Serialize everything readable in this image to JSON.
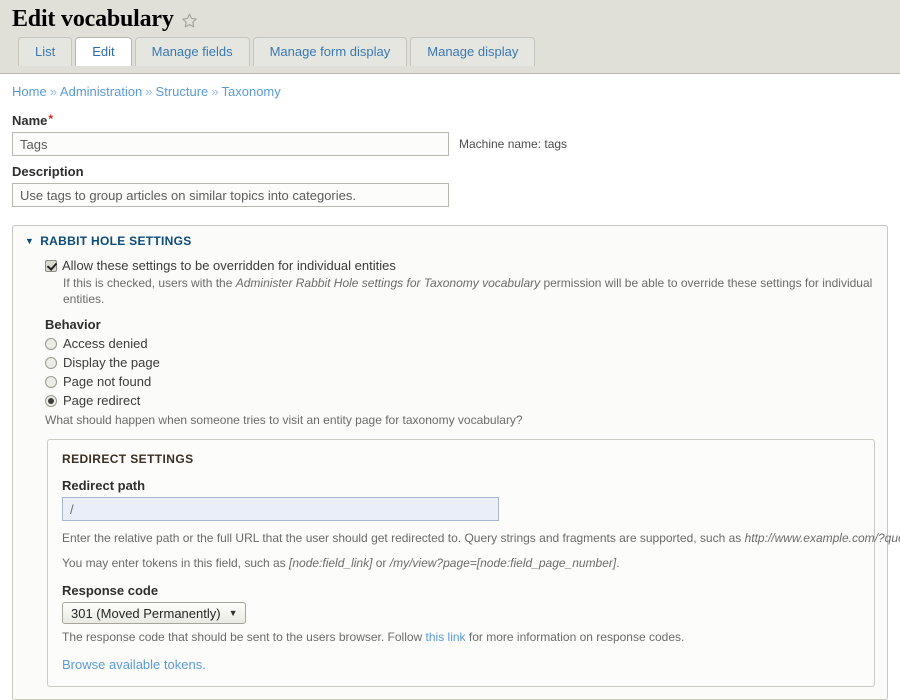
{
  "header": {
    "title": "Edit vocabulary",
    "star_icon": "star-outline-icon"
  },
  "tabs": [
    {
      "label": "List",
      "active": false
    },
    {
      "label": "Edit",
      "active": true
    },
    {
      "label": "Manage fields",
      "active": false
    },
    {
      "label": "Manage form display",
      "active": false
    },
    {
      "label": "Manage display",
      "active": false
    }
  ],
  "breadcrumb": {
    "items": [
      "Home",
      "Administration",
      "Structure",
      "Taxonomy"
    ],
    "separator": "»"
  },
  "form": {
    "name_label": "Name",
    "name_required_mark": "*",
    "name_value": "Tags",
    "machine_name": "Machine name: tags",
    "description_label": "Description",
    "description_value": "Use tags to group articles on similar topics into categories."
  },
  "rabbit_hole": {
    "legend": "RABBIT HOLE SETTINGS",
    "caret": "▼",
    "override_checkbox_label": "Allow these settings to be overridden for individual entities",
    "override_checked": true,
    "override_help_pre": "If this is checked, users with the ",
    "override_help_em": "Administer Rabbit Hole settings for Taxonomy vocabulary",
    "override_help_post": " permission will be able to override these settings for individual entities.",
    "behavior_label": "Behavior",
    "behavior_options": [
      {
        "label": "Access denied",
        "selected": false
      },
      {
        "label": "Display the page",
        "selected": false
      },
      {
        "label": "Page not found",
        "selected": false
      },
      {
        "label": "Page redirect",
        "selected": true
      }
    ],
    "behavior_help": "What should happen when someone tries to visit an entity page for taxonomy vocabulary?"
  },
  "redirect_settings": {
    "title": "REDIRECT SETTINGS",
    "path_label": "Redirect path",
    "path_value": "/",
    "path_help_pre": "Enter the relative path or the full URL that the user should get redirected to. Query strings and fragments are supported, such as ",
    "path_help_em": "http://www.example.com/?query=value#fragment",
    "token_help_pre": "You may enter tokens in this field, such as ",
    "token_help_em1": "[node:field_link]",
    "token_help_mid": " or ",
    "token_help_em2": "/my/view?page=[node:field_page_number]",
    "token_help_post": ".",
    "response_label": "Response code",
    "response_value": "301 (Moved Permanently)",
    "response_caret": "▼",
    "response_help_pre": "The response code that should be sent to the users browser. Follow ",
    "response_help_link": "this link",
    "response_help_post": " for more information on response codes.",
    "browse_tokens_label": "Browse available tokens."
  },
  "colors": {
    "header_bg": "#e0e0d8",
    "link": "#5a9bd8",
    "legend": "#0c4a7a",
    "required": "#e2261a"
  }
}
